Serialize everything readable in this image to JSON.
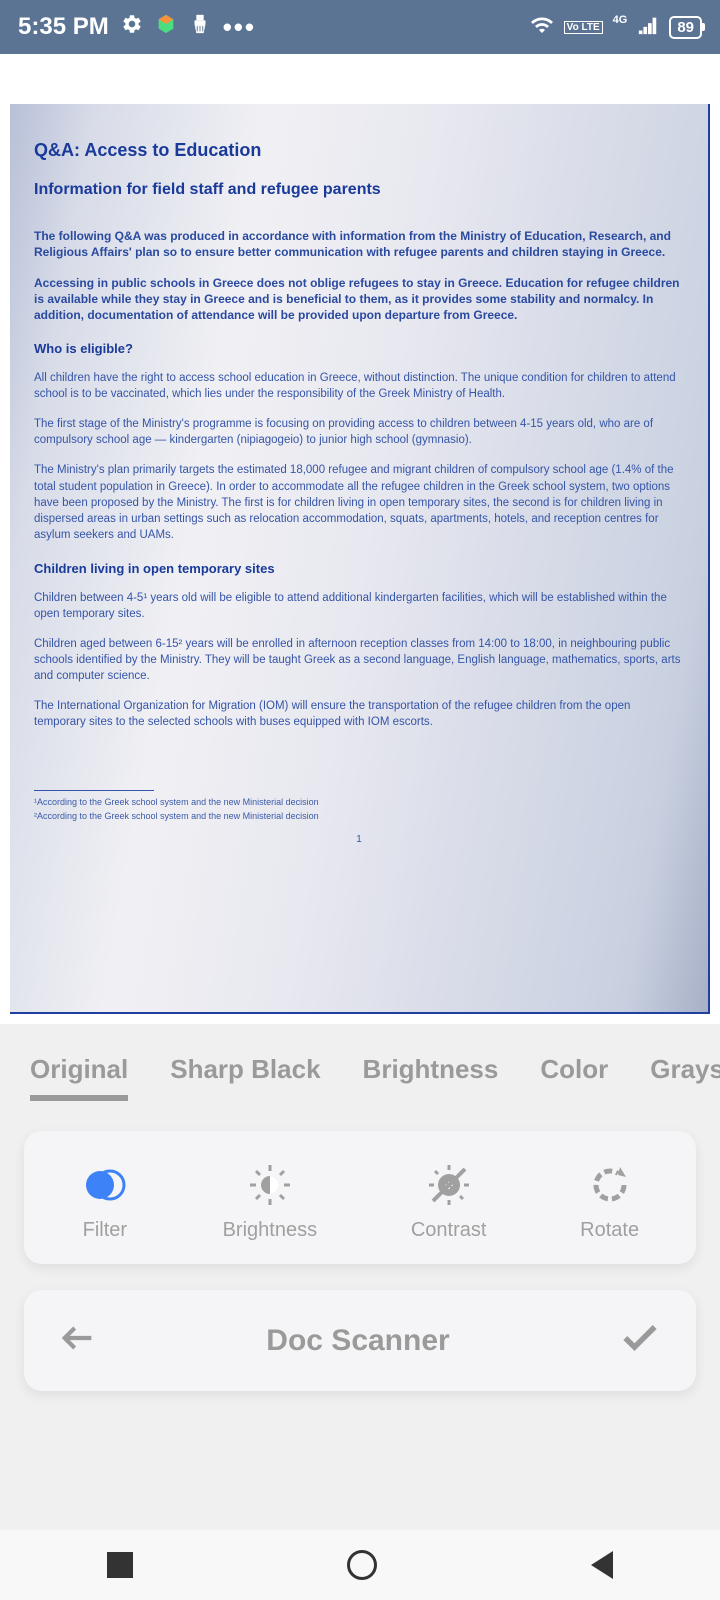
{
  "status": {
    "time": "5:35 PM",
    "network_type": "4G",
    "volte": "Vo LTE",
    "battery": "89"
  },
  "document": {
    "title": "Q&A: Access to Education",
    "subtitle": "Information for field staff and refugee parents",
    "intro1": "The following Q&A was produced in accordance with information from the Ministry of Education, Research, and Religious Affairs' plan so to ensure better communication with refugee parents and children staying in Greece.",
    "intro2": "Accessing in public schools in Greece does not oblige refugees to stay in Greece. Education for refugee children is available while they stay in Greece and is beneficial to them, as it provides some stability and normalcy. In addition, documentation of attendance will be provided upon departure from Greece.",
    "section1_title": "Who is eligible?",
    "section1_p1": "All children have the right to access school education in Greece, without distinction. The unique condition for children to attend school is to be vaccinated, which lies under the responsibility of the Greek Ministry of Health.",
    "section1_p2": "The first stage of the Ministry's programme is focusing on providing access to children between 4-15 years old, who are of compulsory school age — kindergarten (nipiagogeio) to junior high school (gymnasio).",
    "section1_p3": "The Ministry's plan primarily targets the estimated 18,000 refugee and migrant children of compulsory school age (1.4% of the total student population in Greece). In order to accommodate all the refugee children in the Greek school system, two options have been proposed by the Ministry. The first is for children living in open temporary sites, the second is for children living in dispersed areas in urban settings such as relocation accommodation, squats, apartments, hotels, and reception centres for asylum seekers and UAMs.",
    "section2_title": "Children living in open temporary sites",
    "section2_p1": "Children between 4-5¹ years old will be eligible to attend additional kindergarten facilities, which will be established within the open temporary sites.",
    "section2_p2": "Children aged between 6-15² years will be enrolled in afternoon reception classes from 14:00 to 18:00, in neighbouring public schools identified by the Ministry. They will be taught Greek as a second language, English language, mathematics, sports, arts and computer science.",
    "section2_p3": "The International Organization for Migration (IOM) will ensure the transportation of the refugee children from the open temporary sites to the selected schools with buses equipped with IOM escorts.",
    "footnote1": "¹According to the Greek school system and the new Ministerial decision",
    "footnote2": "²According to the Greek school system and the new Ministerial decision",
    "page_number": "1"
  },
  "filters": {
    "tabs": [
      "Original",
      "Sharp Black",
      "Brightness",
      "Color",
      "Grayscale"
    ],
    "active_index": 0
  },
  "tools": {
    "items": [
      {
        "name": "filter",
        "label": "Filter"
      },
      {
        "name": "brightness",
        "label": "Brightness"
      },
      {
        "name": "contrast",
        "label": "Contrast"
      },
      {
        "name": "rotate",
        "label": "Rotate"
      }
    ],
    "active_index": 0
  },
  "bottom": {
    "app_title": "Doc Scanner"
  }
}
